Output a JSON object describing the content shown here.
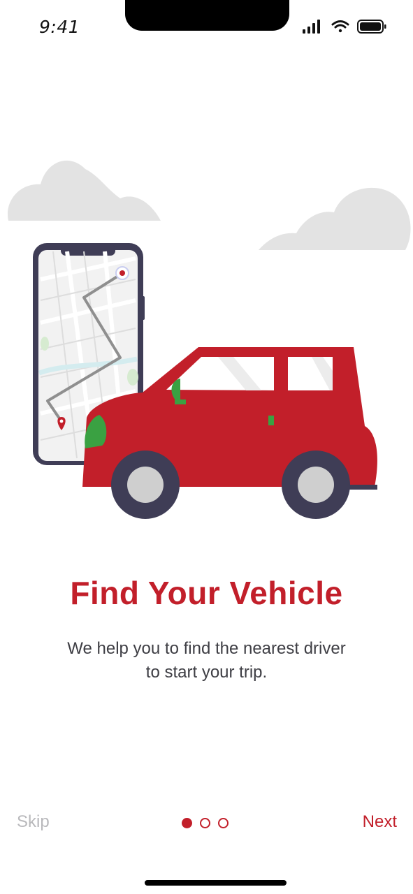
{
  "status_bar": {
    "time": "9:41",
    "icons": [
      "cellular-signal-icon",
      "wifi-icon",
      "battery-icon"
    ]
  },
  "illustration": {
    "elements": [
      "cloud-icon",
      "cloud-icon",
      "phone-map-icon",
      "route-icon",
      "location-pin-icon",
      "car-icon"
    ],
    "colors": {
      "car": "#c21f2a",
      "wheel": "#3f3d56",
      "accent": "#3aa142",
      "cloud": "#e3e3e3"
    }
  },
  "content": {
    "title": "Find Your Vehicle",
    "subtitle": "We help you to find the nearest driver to start your trip."
  },
  "footer": {
    "skip_label": "Skip",
    "next_label": "Next",
    "pagination": {
      "total": 3,
      "current": 1
    }
  },
  "colors": {
    "accent": "#c21f2a",
    "text": "#3e3e44",
    "muted": "#b9b9bc"
  }
}
